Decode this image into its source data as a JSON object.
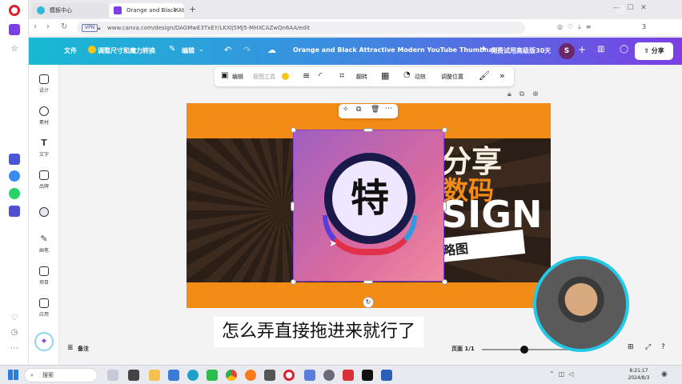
{
  "browser": {
    "tabs": [
      {
        "label": "模板中心"
      },
      {
        "label": "Orange and Black Attra"
      }
    ],
    "new_tab_icon": "plus-icon",
    "url": "www.canva.com/design/DAGMwE3TxEY/LKXIj5MJ5-MHXCAZwQn6AA/edit",
    "vpn_label": "VPN",
    "tab_count": "3"
  },
  "canva_header": {
    "file_menu": "文件",
    "resize_label": "调整尺寸和魔力转换",
    "edit_label": "编辑",
    "doc_title": "Orange and Black Attractive Modern YouTube Thumbnail",
    "trial_label": "免费试用高级版30天",
    "avatar_letter": "S",
    "share_label": "分享"
  },
  "left_panel": {
    "items": [
      {
        "label": "设计"
      },
      {
        "label": "素材"
      },
      {
        "label": "文字"
      },
      {
        "label": "品牌"
      },
      {
        "label": "上传"
      },
      {
        "label": "画笔"
      },
      {
        "label": "项目"
      },
      {
        "label": "应用"
      }
    ]
  },
  "toolbar": {
    "edit": "编辑",
    "bg_tool": "抠图工具",
    "flip": "翻转",
    "animate": "动效",
    "position": "调整位置"
  },
  "canvas": {
    "text_share": "分享",
    "text_code": "数码",
    "text_sign": "SIGN",
    "text_thumb": "视频缩略图",
    "badge_char": "特"
  },
  "subtitle": "怎么弄直接拖进来就行了",
  "bottom": {
    "notes": "备注",
    "page": "页面 1/1"
  },
  "taskbar": {
    "search_placeholder": "搜索",
    "time": "8:21:17",
    "date": "2024/8/3"
  },
  "colors": {
    "canvas_orange": "#f28c16",
    "canva_gradient_start": "#18b9d3",
    "canva_gradient_end": "#7b3fe4",
    "selection_purple": "#8b3fd9",
    "cam_ring": "#23c8e6"
  }
}
